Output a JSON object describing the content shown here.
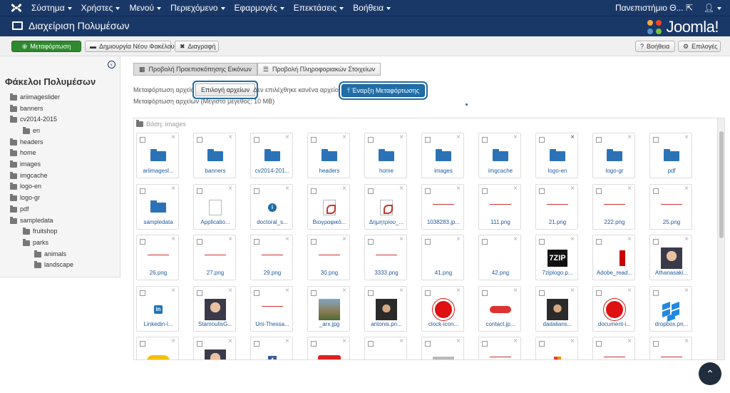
{
  "navbar": {
    "menu": [
      "Σύστημα",
      "Χρήστες",
      "Μενού",
      "Περιεχόμενο",
      "Εφαρμογές",
      "Επεκτάσεις",
      "Βοήθεια"
    ],
    "site_name": "Πανεπιστήμιο Θ...",
    "user_icon": "user-icon"
  },
  "header": {
    "title": "Διαχείριση Πολυμέσων",
    "logo_text": "Joomla!"
  },
  "toolbar": {
    "upload": "Μεταφόρτωση",
    "new_folder": "Δημιουργία Νέου Φακέλου",
    "delete": "Διαγραφή",
    "help": "Βοήθεια",
    "options": "Επιλογές"
  },
  "sidebar": {
    "title": "Φάκελοι Πολυμέσων",
    "folders": [
      {
        "label": "ariimageslider",
        "depth": 0
      },
      {
        "label": "banners",
        "depth": 0
      },
      {
        "label": "cv2014-2015",
        "depth": 0
      },
      {
        "label": "en",
        "depth": 1
      },
      {
        "label": "headers",
        "depth": 0
      },
      {
        "label": "home",
        "depth": 0
      },
      {
        "label": "images",
        "depth": 0
      },
      {
        "label": "imgcache",
        "depth": 0
      },
      {
        "label": "logo-en",
        "depth": 0
      },
      {
        "label": "logo-gr",
        "depth": 0
      },
      {
        "label": "pdf",
        "depth": 0
      },
      {
        "label": "sampledata",
        "depth": 0
      },
      {
        "label": "fruitshop",
        "depth": 1
      },
      {
        "label": "parks",
        "depth": 1
      },
      {
        "label": "animals",
        "depth": 2
      },
      {
        "label": "landscape",
        "depth": 2
      }
    ]
  },
  "main": {
    "tab_thumbs": "Προβολή Προεπισκόπησης Εικόνων",
    "tab_details": "Προβολή Πληροφοριακών Στοιχείων",
    "upload_label": "Μεταφόρτωση αρχείου",
    "choose_files": "Επιλογή αρχείων",
    "no_file": "Δεν επιλέχθηκε κανένα αρχείο.",
    "start_upload": "Έναρξη Μεταφόρτωσης",
    "max_size": "Μεταφόρτωση αρχείων (Μέγιστο μέγεθος: 10 MB)",
    "base_path": "Βάση: images"
  },
  "files": [
    {
      "label": "ariimagesl...",
      "kind": "folder"
    },
    {
      "label": "banners",
      "kind": "folder"
    },
    {
      "label": "cv2014-201...",
      "kind": "folder"
    },
    {
      "label": "headers",
      "kind": "folder"
    },
    {
      "label": "home",
      "kind": "folder"
    },
    {
      "label": "images",
      "kind": "folder"
    },
    {
      "label": "imgcache",
      "kind": "folder"
    },
    {
      "label": "logo-en",
      "kind": "folder"
    },
    {
      "label": "logo-gr",
      "kind": "folder"
    },
    {
      "label": "pdf",
      "kind": "folder"
    },
    {
      "label": "sampledata",
      "kind": "folder"
    },
    {
      "label": "Applicatio...",
      "kind": "doc"
    },
    {
      "label": "doctoral_s...",
      "kind": "info"
    },
    {
      "label": "Βιογραφικό...",
      "kind": "pdf"
    },
    {
      "label": "Δημητρίου_...",
      "kind": "pdf"
    },
    {
      "label": "1038283.jp...",
      "kind": "logo"
    },
    {
      "label": "111.png",
      "kind": "logo"
    },
    {
      "label": "21.png",
      "kind": "logo"
    },
    {
      "label": "222.png",
      "kind": "logo"
    },
    {
      "label": "25.png",
      "kind": "logo"
    },
    {
      "label": "26.png",
      "kind": "logo"
    },
    {
      "label": "27.png",
      "kind": "logo"
    },
    {
      "label": "29.png",
      "kind": "logo"
    },
    {
      "label": "30.png",
      "kind": "logo"
    },
    {
      "label": "3333.png",
      "kind": "logo"
    },
    {
      "label": "41.png",
      "kind": "blank"
    },
    {
      "label": "42.png",
      "kind": "blank"
    },
    {
      "label": "7ziplogo.p...",
      "kind": "zip"
    },
    {
      "label": "Adobe_read...",
      "kind": "adobe"
    },
    {
      "label": "Athanasaki...",
      "kind": "face"
    },
    {
      "label": "Linkedin-l...",
      "kind": "linkedin"
    },
    {
      "label": "StamoulisG...",
      "kind": "face"
    },
    {
      "label": "Uni-Thessa...",
      "kind": "logo"
    },
    {
      "label": "_arx.jpg",
      "kind": "land"
    },
    {
      "label": "antonis.pn...",
      "kind": "dark"
    },
    {
      "label": "clock-icon...",
      "kind": "circle"
    },
    {
      "label": "contact.jp...",
      "kind": "contact"
    },
    {
      "label": "dadalians...",
      "kind": "dark"
    },
    {
      "label": "document-i...",
      "kind": "circle"
    },
    {
      "label": "dropbox.pn...",
      "kind": "dropbox"
    },
    {
      "label": "",
      "kind": "yellow"
    },
    {
      "label": "",
      "kind": "face"
    },
    {
      "label": "",
      "kind": "fb"
    },
    {
      "label": "",
      "kind": "mail"
    },
    {
      "label": "",
      "kind": "firefox"
    },
    {
      "label": "",
      "kind": "graybar"
    },
    {
      "label": "",
      "kind": "logo"
    },
    {
      "label": "",
      "kind": "multi"
    },
    {
      "label": "",
      "kind": "logo"
    },
    {
      "label": "",
      "kind": "logo"
    }
  ],
  "colors": {
    "navbar": "#1a3867",
    "upload_button": "#2f8a2f",
    "accent": "#1f6ea8"
  }
}
